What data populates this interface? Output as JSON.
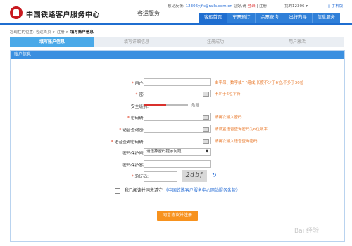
{
  "header": {
    "brand": "中国铁路客户服务中心",
    "sub": "客运服务",
    "feedback_label": "意见反馈:",
    "feedback_email": "12306yjfk@rails.com.cn",
    "hello": "您好,请",
    "login": "登录",
    "register": "注册",
    "my": "我的12306 ▾",
    "mobile": "手机版",
    "nav": [
      "客运首页",
      "车票预订",
      "余票查询",
      "出行向导",
      "信息服务"
    ]
  },
  "breadcrumb": {
    "prefix": "您现在的位置: 客运首页 > 注册 >",
    "current": "填写账户信息"
  },
  "steps": [
    "填写账户信息",
    "填写详细信息",
    "注册成功",
    "用户激活"
  ],
  "panel_title": "账户信息",
  "form": {
    "username": {
      "label": "用户名:",
      "hint": "由字母、数字或\"_\"组成,长度不少于6位,不多于30位"
    },
    "password": {
      "label": "密码:",
      "hint": "不少于6位字符"
    },
    "strength": {
      "label": "安全级别:",
      "value": "危险",
      "level": 0.5
    },
    "confirm": {
      "label": "密码确认:",
      "hint": "请再次输入密码"
    },
    "voice_pwd": {
      "label": "语音查询密码:",
      "hint": "请设置语音查询密码为6位数字"
    },
    "voice_confirm": {
      "label": "语音查询密码确认:",
      "hint": "请再次输入语音查询密码"
    },
    "question": {
      "label": "密码保护问题:",
      "value": "请选择密码提示问题"
    },
    "answer": {
      "label": "密码保护答案:"
    },
    "captcha": {
      "label": "验证码:",
      "image_text": "2dbf",
      "refresh": "↻"
    },
    "agree": {
      "prefix": "我已阅读并同意遵守",
      "link": "《中国铁路客户服务中心网站服务条款》"
    },
    "submit": "同意协议并注册"
  },
  "watermark": "Bai 经验"
}
